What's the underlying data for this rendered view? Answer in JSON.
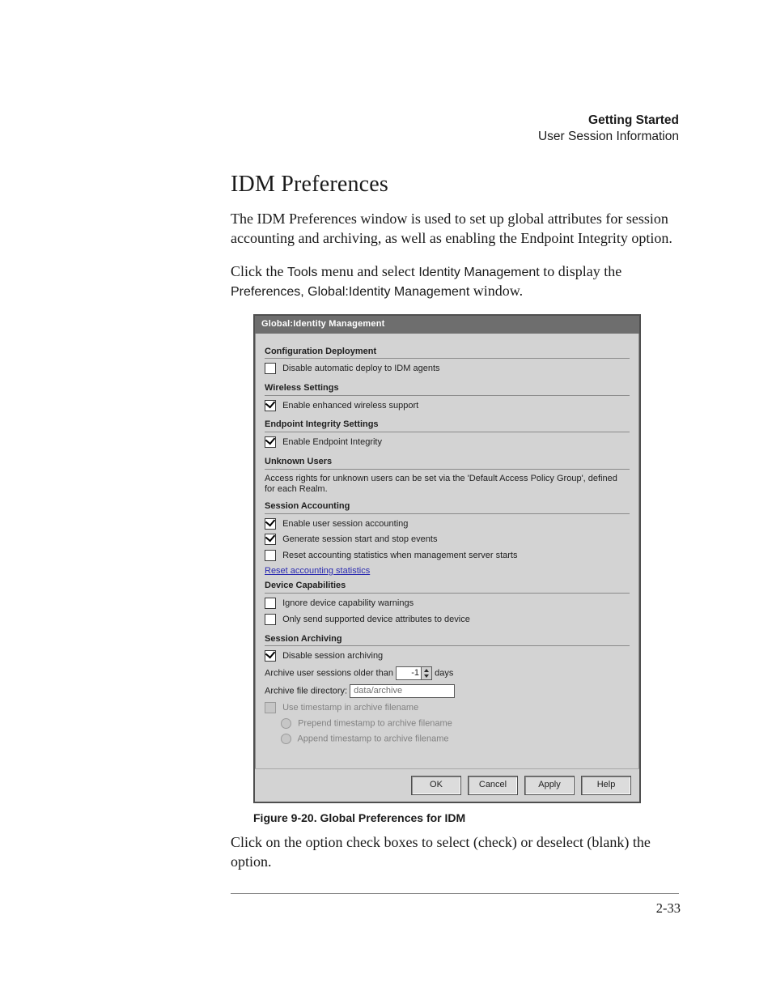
{
  "header": {
    "chapter": "Getting Started",
    "section": "User Session Information"
  },
  "heading": "IDM Preferences",
  "para1": "The IDM Preferences window is used to set up global attributes for session accounting and archiving, as well as enabling the Endpoint Integrity option.",
  "para2a": "Click the ",
  "para2_tools": "Tools",
  "para2b": " menu and select ",
  "para2_im": "Identity Management",
  "para2c": " to display the ",
  "para2_pref": "Preferences, Global:Identity Management",
  "para2d": " window.",
  "dialog": {
    "title": "Global:Identity Management",
    "g_deploy": "Configuration Deployment",
    "deploy_disable": "Disable automatic deploy to IDM agents",
    "g_wireless": "Wireless Settings",
    "wireless_enable": "Enable enhanced wireless support",
    "g_endpoint": "Endpoint Integrity Settings",
    "endpoint_enable": "Enable Endpoint Integrity",
    "g_unknown": "Unknown Users",
    "unknown_note": "Access rights for unknown users can be set via the 'Default Access Policy Group', defined for each Realm.",
    "g_session_acc": "Session Accounting",
    "sa_enable": "Enable user session accounting",
    "sa_events": "Generate session start and stop events",
    "sa_reset_on_start": "Reset accounting statistics when management server starts",
    "sa_reset_link": "Reset accounting statistics",
    "g_devcaps": "Device Capabilities",
    "dc_ignore": "Ignore device capability warnings",
    "dc_only_supported": "Only send supported device attributes to device",
    "g_session_arch": "Session Archiving",
    "sarch_disable": "Disable session archiving",
    "sarch_older_pre": "Archive user sessions older than",
    "sarch_days_val": "-1",
    "sarch_older_post": "days",
    "sarch_dir_label": "Archive file directory:",
    "sarch_dir_value": "data/archive",
    "sarch_ts_use": "Use timestamp in archive filename",
    "sarch_ts_prepend": "Prepend timestamp to archive filename",
    "sarch_ts_append": "Append timestamp to archive filename",
    "btn_ok": "OK",
    "btn_cancel": "Cancel",
    "btn_apply": "Apply",
    "btn_help": "Help"
  },
  "figcaption": "Figure 9-20. Global Preferences for IDM",
  "para3": "Click on the option check boxes to select (check) or deselect (blank) the option.",
  "pagenum": "2-33"
}
